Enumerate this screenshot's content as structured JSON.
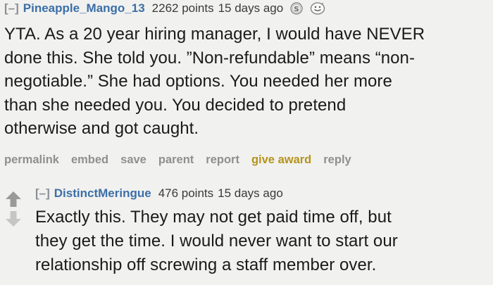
{
  "parent_comment": {
    "collapse_label": "[–]",
    "author": "Pineapple_Mango_13",
    "score": "2262 points",
    "time": "15 days ago",
    "body_lines": [
      "YTA. As a 20 year hiring manager, I would have NEVER",
      "done this. She told you. ”Non-refundable” means “non-",
      "negotiable.” She had options. You needed her more",
      "than she needed you. You decided to pretend",
      "otherwise and got caught."
    ],
    "actions": {
      "permalink": "permalink",
      "embed": "embed",
      "save": "save",
      "parent": "parent",
      "report": "report",
      "give_award": "give award",
      "reply": "reply"
    }
  },
  "child_comment": {
    "collapse_label": "[–]",
    "author": "DistinctMeringue",
    "score": "476 points",
    "time": "15 days ago",
    "body_lines": [
      "Exactly this. They may not get paid time off, but",
      "they get the time. I would never want to start our",
      "relationship off screwing a staff member over."
    ]
  },
  "colors": {
    "background": "#f1f1ef",
    "author_link": "#3b6fa8",
    "award": "#b5941b",
    "muted": "#8f8f8f"
  },
  "icons": {
    "award_badges": [
      "silver-s-award-icon",
      "smiley-award-icon"
    ],
    "vote": [
      "upvote-arrow-icon",
      "downvote-arrow-icon"
    ]
  }
}
